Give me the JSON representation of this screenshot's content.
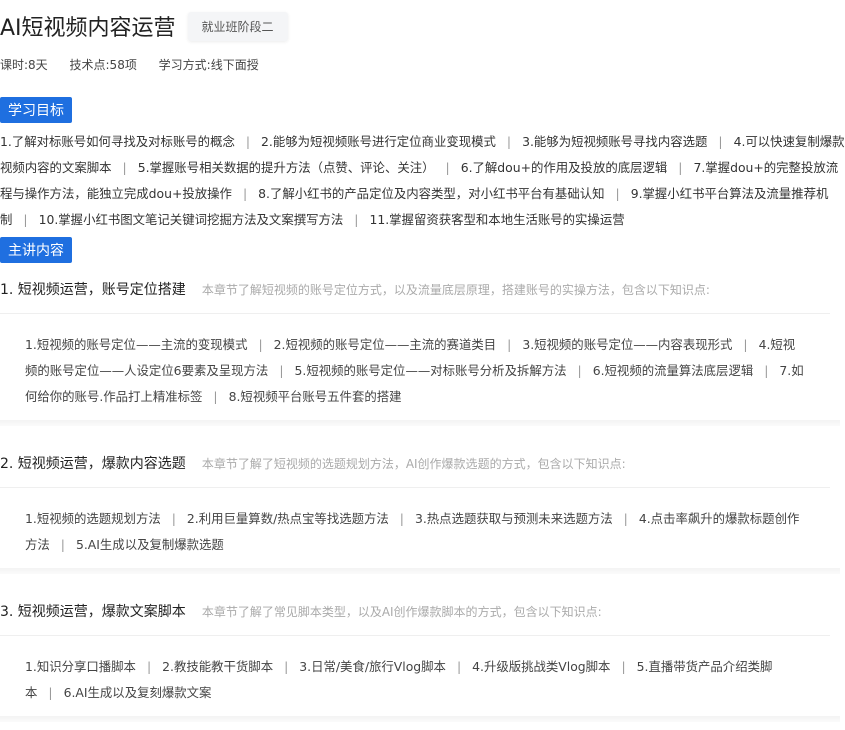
{
  "header": {
    "title": "AI短视频内容运营",
    "stage_badge": "就业班阶段二"
  },
  "meta": {
    "hours": "课时:8天",
    "points": "技术点:58项",
    "mode": "学习方式:线下面授"
  },
  "sections": {
    "goals_label": "学习目标",
    "content_label": "主讲内容"
  },
  "goals": [
    "1.了解对标账号如何寻找及对标账号的概念",
    "2.能够为短视频账号进行定位商业变现模式",
    "3.能够为短视频账号寻找内容选题",
    "4.可以快速复制爆款视频内容的文案脚本",
    "5.掌握账号相关数据的提升方法（点赞、评论、关注）",
    "6.了解dou+的作用及投放的底层逻辑",
    "7.掌握dou+的完整投放流程与操作方法，能独立完成dou+投放操作",
    "8.了解小红书的产品定位及内容类型，对小红书平台有基础认知",
    "9.掌握小红书平台算法及流量推荐机制",
    "10.掌握小红书图文笔记关键词挖掘方法及文案撰写方法",
    "11.掌握留资获客型和本地生活账号的实操运营"
  ],
  "chapters": [
    {
      "title": "1. 短视频运营，账号定位搭建",
      "desc": "本章节了解短视频的账号定位方式，以及流量底层原理，搭建账号的实操方法，包含以下知识点:",
      "points": [
        "1.短视频的账号定位——主流的变现模式",
        "2.短视频的账号定位——主流的赛道类目",
        "3.短视频的账号定位——内容表现形式",
        "4.短视频的账号定位——人设定位6要素及呈现方法",
        "5.短视频的账号定位——对标账号分析及拆解方法",
        "6.短视频的流量算法底层逻辑",
        "7.如何给你的账号.作品打上精准标签",
        "8.短视频平台账号五件套的搭建"
      ]
    },
    {
      "title": "2. 短视频运营，爆款内容选题",
      "desc": "本章节了解了短视频的选题规划方法，AI创作爆款选题的方式，包含以下知识点:",
      "points": [
        "1.短视频的选题规划方法",
        "2.利用巨量算数/热点宝等找选题方法",
        "3.热点选题获取与预测未来选题方法",
        "4.点击率飙升的爆款标题创作方法",
        "5.AI生成以及复制爆款选题"
      ]
    },
    {
      "title": "3. 短视频运营，爆款文案脚本",
      "desc": "本章节了解了常见脚本类型，以及AI创作爆款脚本的方式，包含以下知识点:",
      "points": [
        "1.知识分享口播脚本",
        "2.教技能教干货脚本",
        "3.日常/美食/旅行Vlog脚本",
        "4.升级版挑战类Vlog脚本",
        "5.直播带货产品介绍类脚本",
        "6.AI生成以及复刻爆款文案"
      ]
    }
  ]
}
